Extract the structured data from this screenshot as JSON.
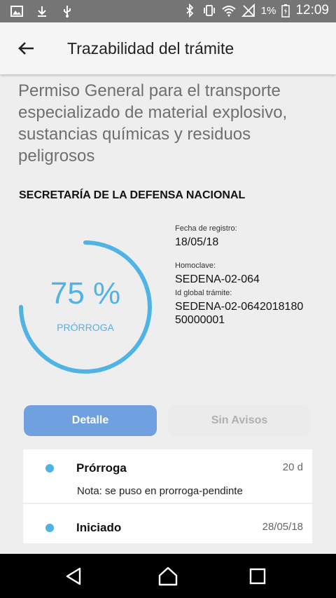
{
  "status_bar": {
    "left_icons": [
      "image-icon",
      "download-icon",
      "usb-icon"
    ],
    "right_icons": [
      "bluetooth-icon",
      "vibrate-icon",
      "wifi-icon",
      "no-signal-icon",
      "battery-icon"
    ],
    "battery": "1%",
    "time": "12:09"
  },
  "app_bar": {
    "title": "Trazabilidad del trámite",
    "back_icon": "arrow-left-icon"
  },
  "procedure": {
    "title": "Permiso General para el transporte especializado de material explosivo, sustancias químicas y residuos peligrosos",
    "agency": "SECRETARÍA DE LA DEFENSA NACIONAL"
  },
  "progress": {
    "value": 0.75,
    "percent_label": "75 %",
    "status_label": "PRÓRROGA",
    "color": "#4fb3e6"
  },
  "info": {
    "registration_label": "Fecha de registro:",
    "registration_value": "18/05/18",
    "homoclave_label": "Homoclave:",
    "homoclave_value": "SEDENA-02-064",
    "global_id_label": "Id global trámite:",
    "global_id_value_line1": "SEDENA-02-0642018180",
    "global_id_value_line2": "50000001"
  },
  "tabs": {
    "active": "Detalle",
    "inactive": "Sin Avisos"
  },
  "events": [
    {
      "title": "Prórroga",
      "date": "20 d",
      "note": "Nota: se puso en prorroga-pendinte"
    },
    {
      "title": "Iniciado",
      "date": "28/05/18"
    }
  ],
  "nav_bar": {
    "icons": [
      "back-triangle-icon",
      "home-icon",
      "recents-icon"
    ]
  },
  "colors": {
    "accent": "#4fb3e6",
    "tab_active": "#6fa0e0",
    "status_bar": "#757575"
  }
}
